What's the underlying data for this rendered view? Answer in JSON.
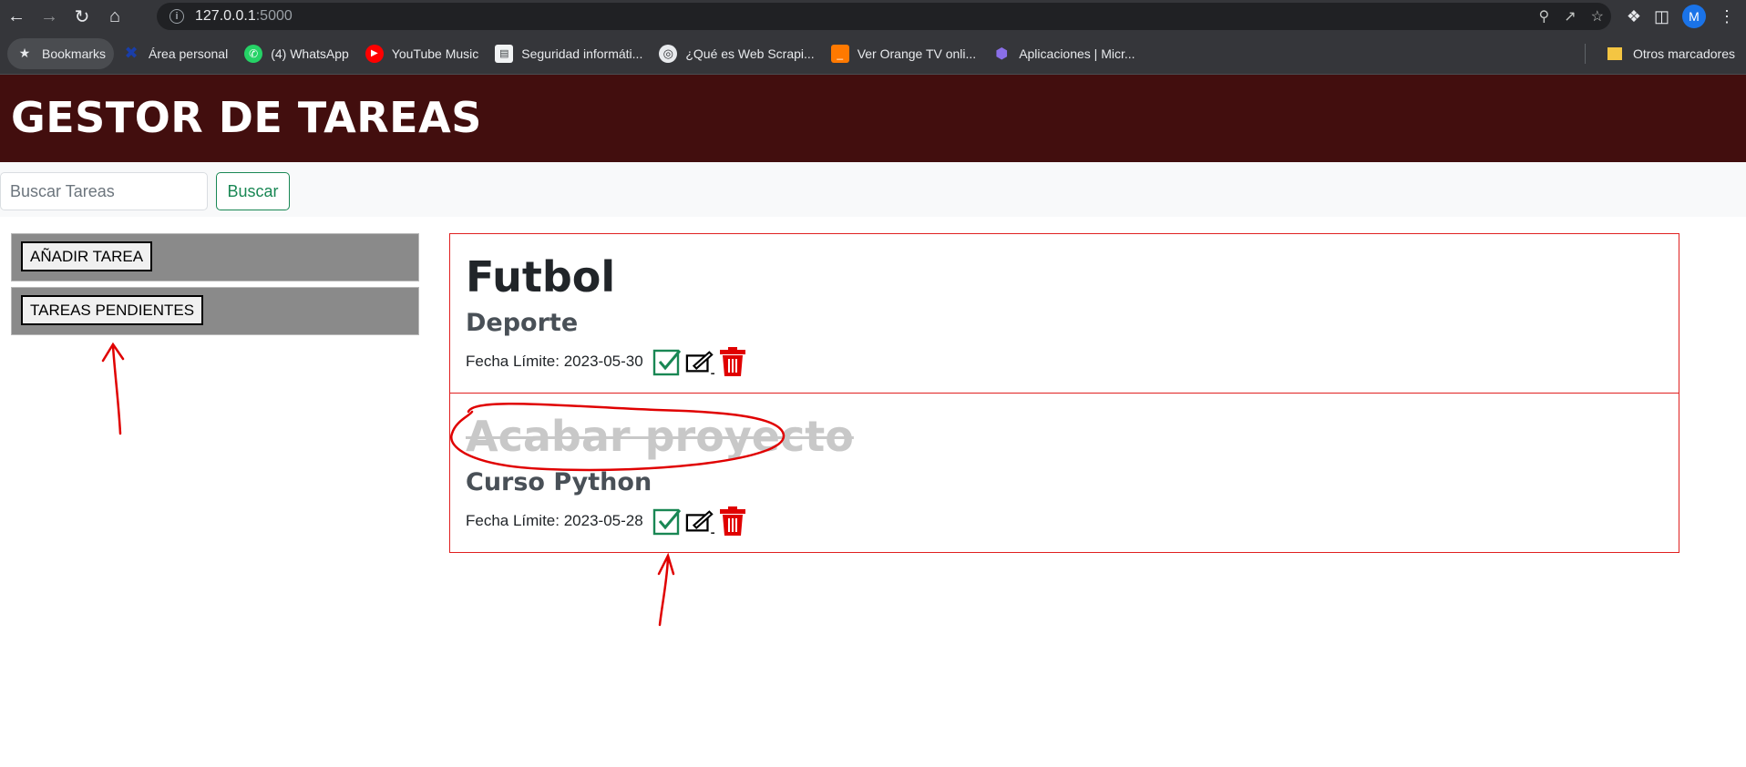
{
  "browser": {
    "url_host": "127.0.0.1",
    "url_port": ":5000",
    "profile_initial": "M",
    "bookmarks": [
      {
        "label": "Bookmarks",
        "icon": "star-icon"
      },
      {
        "label": "Área personal",
        "icon": "puzzle-icon"
      },
      {
        "label": "(4) WhatsApp",
        "icon": "whatsapp-icon"
      },
      {
        "label": "YouTube Music",
        "icon": "youtube-music-icon"
      },
      {
        "label": "Seguridad informáti...",
        "icon": "doc-icon"
      },
      {
        "label": "¿Qué es Web Scrapi...",
        "icon": "globe-icon"
      },
      {
        "label": "Ver Orange TV onli...",
        "icon": "orange-icon"
      },
      {
        "label": "Aplicaciones | Micr...",
        "icon": "apps-icon"
      }
    ],
    "other_bookmarks": "Otros marcadores"
  },
  "app": {
    "title": "GESTOR DE TAREAS",
    "search_placeholder": "Buscar Tareas",
    "search_button": "Buscar",
    "add_task": "AÑADIR TAREA",
    "pending_tasks": "TAREAS PENDIENTES"
  },
  "tasks": [
    {
      "title": "Futbol",
      "category": "Deporte",
      "deadline": "Fecha Límite: 2023-05-30",
      "completed": false
    },
    {
      "title": "Acabar proyecto",
      "category": "Curso Python",
      "deadline": "Fecha Límite: 2023-05-28",
      "completed": true
    }
  ],
  "colors": {
    "header_bg": "#420e0e",
    "accent_green": "#198754",
    "task_border": "#e02020",
    "annotation": "#e00000"
  }
}
